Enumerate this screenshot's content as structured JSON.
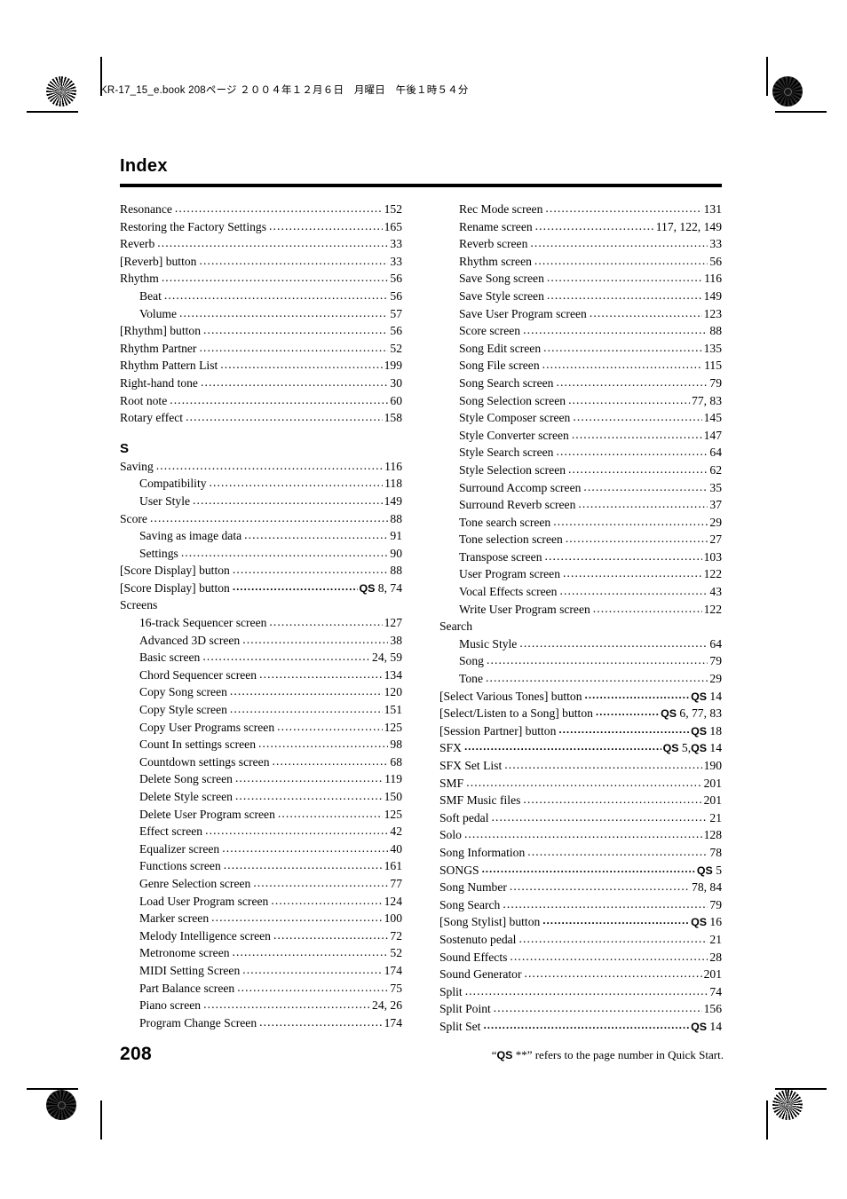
{
  "header": {
    "running_head": "KR-17_15_e.book  208ページ  ２００４年１２月６日　月曜日　午後１時５４分"
  },
  "title": "Index",
  "footer": {
    "page_number": "208",
    "note_prefix": "“",
    "note_qs": "QS",
    "note_suffix": " **” refers to the page number in Quick Start."
  },
  "columns": [
    {
      "id": "left",
      "blocks": [
        {
          "type": "entries",
          "items": [
            {
              "label": "Resonance",
              "pages": "152",
              "level": 0,
              "leader": true,
              "qs": false
            },
            {
              "label": "Restoring the Factory Settings",
              "pages": "165",
              "level": 0,
              "leader": true,
              "qs": false
            },
            {
              "label": "Reverb",
              "pages": "33",
              "level": 0,
              "leader": true,
              "qs": false
            },
            {
              "label": "[Reverb] button",
              "pages": "33",
              "level": 0,
              "leader": true,
              "qs": false
            },
            {
              "label": "Rhythm",
              "pages": "56",
              "level": 0,
              "leader": true,
              "qs": false
            },
            {
              "label": "Beat",
              "pages": "56",
              "level": 1,
              "leader": true,
              "qs": false
            },
            {
              "label": "Volume",
              "pages": "57",
              "level": 1,
              "leader": true,
              "qs": false
            },
            {
              "label": "[Rhythm] button",
              "pages": "56",
              "level": 0,
              "leader": true,
              "qs": false
            },
            {
              "label": "Rhythm Partner",
              "pages": "52",
              "level": 0,
              "leader": true,
              "qs": false
            },
            {
              "label": "Rhythm Pattern List",
              "pages": "199",
              "level": 0,
              "leader": true,
              "qs": false
            },
            {
              "label": "Right-hand tone",
              "pages": "30",
              "level": 0,
              "leader": true,
              "qs": false
            },
            {
              "label": "Root note",
              "pages": "60",
              "level": 0,
              "leader": true,
              "qs": false
            },
            {
              "label": "Rotary effect",
              "pages": "158",
              "level": 0,
              "leader": true,
              "qs": false
            }
          ]
        },
        {
          "type": "letter",
          "letter": "S"
        },
        {
          "type": "entries",
          "items": [
            {
              "label": "Saving",
              "pages": "116",
              "level": 0,
              "leader": true,
              "qs": false
            },
            {
              "label": "Compatibility",
              "pages": "118",
              "level": 1,
              "leader": true,
              "qs": false
            },
            {
              "label": "User Style",
              "pages": "149",
              "level": 1,
              "leader": true,
              "qs": false
            },
            {
              "label": "Score",
              "pages": "88",
              "level": 0,
              "leader": true,
              "qs": false
            },
            {
              "label": "Saving as image data",
              "pages": "91",
              "level": 1,
              "leader": true,
              "qs": false
            },
            {
              "label": "Settings",
              "pages": "90",
              "level": 1,
              "leader": true,
              "qs": false
            },
            {
              "label": "[Score Display] button",
              "pages": "88",
              "level": 0,
              "leader": true,
              "qs": false
            },
            {
              "label": "[Score Display] button",
              "pages": "8, 74",
              "level": 0,
              "leader": true,
              "qs": true
            },
            {
              "label": "Screens",
              "pages": "",
              "level": 0,
              "leader": false,
              "qs": false
            },
            {
              "label": "16-track Sequencer screen",
              "pages": "127",
              "level": 1,
              "leader": true,
              "qs": false
            },
            {
              "label": "Advanced 3D screen",
              "pages": "38",
              "level": 1,
              "leader": true,
              "qs": false
            },
            {
              "label": "Basic screen",
              "pages": "24, 59",
              "level": 1,
              "leader": true,
              "qs": false
            },
            {
              "label": "Chord Sequencer screen",
              "pages": "134",
              "level": 1,
              "leader": true,
              "qs": false
            },
            {
              "label": "Copy Song screen",
              "pages": "120",
              "level": 1,
              "leader": true,
              "qs": false
            },
            {
              "label": "Copy Style screen",
              "pages": "151",
              "level": 1,
              "leader": true,
              "qs": false
            },
            {
              "label": "Copy User Programs screen",
              "pages": "125",
              "level": 1,
              "leader": true,
              "qs": false
            },
            {
              "label": "Count In settings screen",
              "pages": "98",
              "level": 1,
              "leader": true,
              "qs": false
            },
            {
              "label": "Countdown settings screen",
              "pages": "68",
              "level": 1,
              "leader": true,
              "qs": false
            },
            {
              "label": "Delete Song screen",
              "pages": "119",
              "level": 1,
              "leader": true,
              "qs": false
            },
            {
              "label": "Delete Style screen",
              "pages": "150",
              "level": 1,
              "leader": true,
              "qs": false
            },
            {
              "label": "Delete User Program screen",
              "pages": "125",
              "level": 1,
              "leader": true,
              "qs": false
            },
            {
              "label": "Effect screen",
              "pages": "42",
              "level": 1,
              "leader": true,
              "qs": false
            },
            {
              "label": "Equalizer screen",
              "pages": "40",
              "level": 1,
              "leader": true,
              "qs": false
            },
            {
              "label": "Functions screen",
              "pages": "161",
              "level": 1,
              "leader": true,
              "qs": false
            },
            {
              "label": "Genre Selection screen",
              "pages": "77",
              "level": 1,
              "leader": true,
              "qs": false
            },
            {
              "label": "Load User Program screen",
              "pages": "124",
              "level": 1,
              "leader": true,
              "qs": false
            },
            {
              "label": "Marker screen",
              "pages": "100",
              "level": 1,
              "leader": true,
              "qs": false
            },
            {
              "label": "Melody Intelligence screen",
              "pages": "72",
              "level": 1,
              "leader": true,
              "qs": false
            },
            {
              "label": "Metronome screen",
              "pages": "52",
              "level": 1,
              "leader": true,
              "qs": false
            },
            {
              "label": "MIDI Setting Screen",
              "pages": "174",
              "level": 1,
              "leader": true,
              "qs": false
            },
            {
              "label": "Part Balance screen",
              "pages": "75",
              "level": 1,
              "leader": true,
              "qs": false
            },
            {
              "label": "Piano screen",
              "pages": "24, 26",
              "level": 1,
              "leader": true,
              "qs": false
            },
            {
              "label": "Program Change Screen",
              "pages": "174",
              "level": 1,
              "leader": true,
              "qs": false
            }
          ]
        }
      ]
    },
    {
      "id": "right",
      "blocks": [
        {
          "type": "entries",
          "items": [
            {
              "label": "Rec Mode screen",
              "pages": "131",
              "level": 1,
              "leader": true,
              "qs": false
            },
            {
              "label": "Rename screen",
              "pages": "117, 122, 149",
              "level": 1,
              "leader": true,
              "qs": false
            },
            {
              "label": "Reverb screen",
              "pages": "33",
              "level": 1,
              "leader": true,
              "qs": false
            },
            {
              "label": "Rhythm screen",
              "pages": "56",
              "level": 1,
              "leader": true,
              "qs": false
            },
            {
              "label": "Save Song screen",
              "pages": "116",
              "level": 1,
              "leader": true,
              "qs": false
            },
            {
              "label": "Save Style screen",
              "pages": "149",
              "level": 1,
              "leader": true,
              "qs": false
            },
            {
              "label": "Save User Program screen",
              "pages": "123",
              "level": 1,
              "leader": true,
              "qs": false
            },
            {
              "label": "Score screen",
              "pages": "88",
              "level": 1,
              "leader": true,
              "qs": false
            },
            {
              "label": "Song Edit screen",
              "pages": "135",
              "level": 1,
              "leader": true,
              "qs": false
            },
            {
              "label": "Song File screen",
              "pages": "115",
              "level": 1,
              "leader": true,
              "qs": false
            },
            {
              "label": "Song Search screen",
              "pages": "79",
              "level": 1,
              "leader": true,
              "qs": false
            },
            {
              "label": "Song Selection screen",
              "pages": "77, 83",
              "level": 1,
              "leader": true,
              "qs": false
            },
            {
              "label": "Style Composer screen",
              "pages": "145",
              "level": 1,
              "leader": true,
              "qs": false
            },
            {
              "label": "Style Converter screen",
              "pages": "147",
              "level": 1,
              "leader": true,
              "qs": false
            },
            {
              "label": "Style Search screen",
              "pages": "64",
              "level": 1,
              "leader": true,
              "qs": false
            },
            {
              "label": "Style Selection screen",
              "pages": "62",
              "level": 1,
              "leader": true,
              "qs": false
            },
            {
              "label": "Surround Accomp screen",
              "pages": "35",
              "level": 1,
              "leader": true,
              "qs": false
            },
            {
              "label": "Surround Reverb screen",
              "pages": "37",
              "level": 1,
              "leader": true,
              "qs": false
            },
            {
              "label": "Tone search screen",
              "pages": "29",
              "level": 1,
              "leader": true,
              "qs": false
            },
            {
              "label": "Tone selection screen",
              "pages": "27",
              "level": 1,
              "leader": true,
              "qs": false
            },
            {
              "label": "Transpose screen",
              "pages": "103",
              "level": 1,
              "leader": true,
              "qs": false
            },
            {
              "label": "User Program screen",
              "pages": "122",
              "level": 1,
              "leader": true,
              "qs": false
            },
            {
              "label": "Vocal Effects screen",
              "pages": "43",
              "level": 1,
              "leader": true,
              "qs": false
            },
            {
              "label": "Write User Program screen",
              "pages": "122",
              "level": 1,
              "leader": true,
              "qs": false
            },
            {
              "label": "Search",
              "pages": "",
              "level": 0,
              "leader": false,
              "qs": false
            },
            {
              "label": "Music Style",
              "pages": "64",
              "level": 1,
              "leader": true,
              "qs": false
            },
            {
              "label": "Song",
              "pages": "79",
              "level": 1,
              "leader": true,
              "qs": false
            },
            {
              "label": "Tone",
              "pages": "29",
              "level": 1,
              "leader": true,
              "qs": false
            },
            {
              "label": "[Select Various Tones] button",
              "pages": "14",
              "level": 0,
              "leader": true,
              "qs": true
            },
            {
              "label": "[Select/Listen to a Song] button",
              "pages": "6, 77, 83",
              "level": 0,
              "leader": true,
              "qs": true
            },
            {
              "label": "[Session Partner] button",
              "pages": "18",
              "level": 0,
              "leader": true,
              "qs": true
            },
            {
              "label": "SFX",
              "pages": "5, QS 14",
              "level": 0,
              "leader": true,
              "qs": true
            },
            {
              "label": "SFX Set List",
              "pages": "190",
              "level": 0,
              "leader": true,
              "qs": false
            },
            {
              "label": "SMF",
              "pages": "201",
              "level": 0,
              "leader": true,
              "qs": false
            },
            {
              "label": "SMF Music files",
              "pages": "201",
              "level": 0,
              "leader": true,
              "qs": false
            },
            {
              "label": "Soft pedal",
              "pages": "21",
              "level": 0,
              "leader": true,
              "qs": false
            },
            {
              "label": "Solo",
              "pages": "128",
              "level": 0,
              "leader": true,
              "qs": false
            },
            {
              "label": "Song Information",
              "pages": "78",
              "level": 0,
              "leader": true,
              "qs": false
            },
            {
              "label": "SONGS",
              "pages": "5",
              "level": 0,
              "leader": true,
              "qs": true
            },
            {
              "label": "Song Number",
              "pages": "78, 84",
              "level": 0,
              "leader": true,
              "qs": false
            },
            {
              "label": "Song Search",
              "pages": "79",
              "level": 0,
              "leader": true,
              "qs": false
            },
            {
              "label": "[Song Stylist] button",
              "pages": "16",
              "level": 0,
              "leader": true,
              "qs": true
            },
            {
              "label": "Sostenuto pedal",
              "pages": "21",
              "level": 0,
              "leader": true,
              "qs": false
            },
            {
              "label": "Sound Effects",
              "pages": "28",
              "level": 0,
              "leader": true,
              "qs": false
            },
            {
              "label": "Sound Generator",
              "pages": "201",
              "level": 0,
              "leader": true,
              "qs": false
            },
            {
              "label": "Split",
              "pages": "74",
              "level": 0,
              "leader": true,
              "qs": false
            },
            {
              "label": "Split Point",
              "pages": "156",
              "level": 0,
              "leader": true,
              "qs": false
            },
            {
              "label": "Split Set",
              "pages": "14",
              "level": 0,
              "leader": true,
              "qs": true
            }
          ]
        }
      ]
    }
  ]
}
